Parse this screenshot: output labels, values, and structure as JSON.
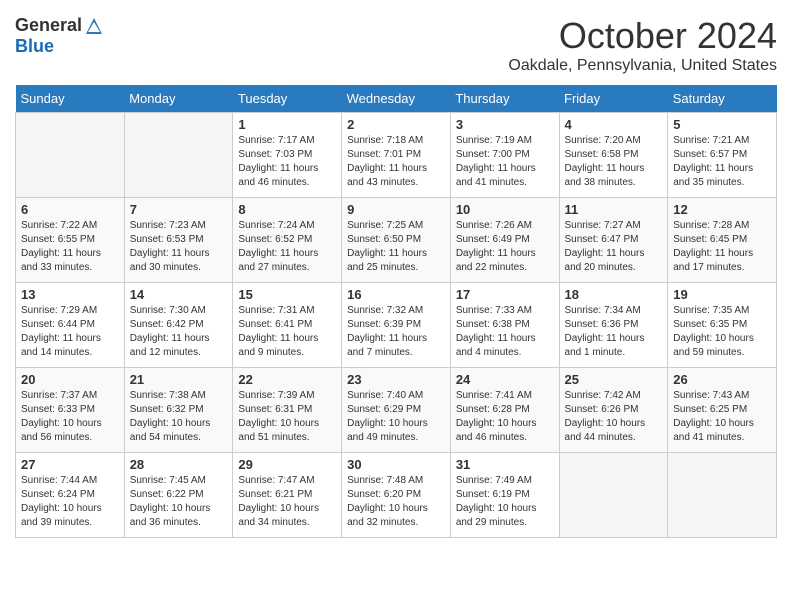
{
  "header": {
    "logo_general": "General",
    "logo_blue": "Blue",
    "month_title": "October 2024",
    "location": "Oakdale, Pennsylvania, United States"
  },
  "days_of_week": [
    "Sunday",
    "Monday",
    "Tuesday",
    "Wednesday",
    "Thursday",
    "Friday",
    "Saturday"
  ],
  "weeks": [
    [
      {
        "day": "",
        "empty": true
      },
      {
        "day": "",
        "empty": true
      },
      {
        "day": "1",
        "sunrise": "Sunrise: 7:17 AM",
        "sunset": "Sunset: 7:03 PM",
        "daylight": "Daylight: 11 hours and 46 minutes."
      },
      {
        "day": "2",
        "sunrise": "Sunrise: 7:18 AM",
        "sunset": "Sunset: 7:01 PM",
        "daylight": "Daylight: 11 hours and 43 minutes."
      },
      {
        "day": "3",
        "sunrise": "Sunrise: 7:19 AM",
        "sunset": "Sunset: 7:00 PM",
        "daylight": "Daylight: 11 hours and 41 minutes."
      },
      {
        "day": "4",
        "sunrise": "Sunrise: 7:20 AM",
        "sunset": "Sunset: 6:58 PM",
        "daylight": "Daylight: 11 hours and 38 minutes."
      },
      {
        "day": "5",
        "sunrise": "Sunrise: 7:21 AM",
        "sunset": "Sunset: 6:57 PM",
        "daylight": "Daylight: 11 hours and 35 minutes."
      }
    ],
    [
      {
        "day": "6",
        "sunrise": "Sunrise: 7:22 AM",
        "sunset": "Sunset: 6:55 PM",
        "daylight": "Daylight: 11 hours and 33 minutes."
      },
      {
        "day": "7",
        "sunrise": "Sunrise: 7:23 AM",
        "sunset": "Sunset: 6:53 PM",
        "daylight": "Daylight: 11 hours and 30 minutes."
      },
      {
        "day": "8",
        "sunrise": "Sunrise: 7:24 AM",
        "sunset": "Sunset: 6:52 PM",
        "daylight": "Daylight: 11 hours and 27 minutes."
      },
      {
        "day": "9",
        "sunrise": "Sunrise: 7:25 AM",
        "sunset": "Sunset: 6:50 PM",
        "daylight": "Daylight: 11 hours and 25 minutes."
      },
      {
        "day": "10",
        "sunrise": "Sunrise: 7:26 AM",
        "sunset": "Sunset: 6:49 PM",
        "daylight": "Daylight: 11 hours and 22 minutes."
      },
      {
        "day": "11",
        "sunrise": "Sunrise: 7:27 AM",
        "sunset": "Sunset: 6:47 PM",
        "daylight": "Daylight: 11 hours and 20 minutes."
      },
      {
        "day": "12",
        "sunrise": "Sunrise: 7:28 AM",
        "sunset": "Sunset: 6:45 PM",
        "daylight": "Daylight: 11 hours and 17 minutes."
      }
    ],
    [
      {
        "day": "13",
        "sunrise": "Sunrise: 7:29 AM",
        "sunset": "Sunset: 6:44 PM",
        "daylight": "Daylight: 11 hours and 14 minutes."
      },
      {
        "day": "14",
        "sunrise": "Sunrise: 7:30 AM",
        "sunset": "Sunset: 6:42 PM",
        "daylight": "Daylight: 11 hours and 12 minutes."
      },
      {
        "day": "15",
        "sunrise": "Sunrise: 7:31 AM",
        "sunset": "Sunset: 6:41 PM",
        "daylight": "Daylight: 11 hours and 9 minutes."
      },
      {
        "day": "16",
        "sunrise": "Sunrise: 7:32 AM",
        "sunset": "Sunset: 6:39 PM",
        "daylight": "Daylight: 11 hours and 7 minutes."
      },
      {
        "day": "17",
        "sunrise": "Sunrise: 7:33 AM",
        "sunset": "Sunset: 6:38 PM",
        "daylight": "Daylight: 11 hours and 4 minutes."
      },
      {
        "day": "18",
        "sunrise": "Sunrise: 7:34 AM",
        "sunset": "Sunset: 6:36 PM",
        "daylight": "Daylight: 11 hours and 1 minute."
      },
      {
        "day": "19",
        "sunrise": "Sunrise: 7:35 AM",
        "sunset": "Sunset: 6:35 PM",
        "daylight": "Daylight: 10 hours and 59 minutes."
      }
    ],
    [
      {
        "day": "20",
        "sunrise": "Sunrise: 7:37 AM",
        "sunset": "Sunset: 6:33 PM",
        "daylight": "Daylight: 10 hours and 56 minutes."
      },
      {
        "day": "21",
        "sunrise": "Sunrise: 7:38 AM",
        "sunset": "Sunset: 6:32 PM",
        "daylight": "Daylight: 10 hours and 54 minutes."
      },
      {
        "day": "22",
        "sunrise": "Sunrise: 7:39 AM",
        "sunset": "Sunset: 6:31 PM",
        "daylight": "Daylight: 10 hours and 51 minutes."
      },
      {
        "day": "23",
        "sunrise": "Sunrise: 7:40 AM",
        "sunset": "Sunset: 6:29 PM",
        "daylight": "Daylight: 10 hours and 49 minutes."
      },
      {
        "day": "24",
        "sunrise": "Sunrise: 7:41 AM",
        "sunset": "Sunset: 6:28 PM",
        "daylight": "Daylight: 10 hours and 46 minutes."
      },
      {
        "day": "25",
        "sunrise": "Sunrise: 7:42 AM",
        "sunset": "Sunset: 6:26 PM",
        "daylight": "Daylight: 10 hours and 44 minutes."
      },
      {
        "day": "26",
        "sunrise": "Sunrise: 7:43 AM",
        "sunset": "Sunset: 6:25 PM",
        "daylight": "Daylight: 10 hours and 41 minutes."
      }
    ],
    [
      {
        "day": "27",
        "sunrise": "Sunrise: 7:44 AM",
        "sunset": "Sunset: 6:24 PM",
        "daylight": "Daylight: 10 hours and 39 minutes."
      },
      {
        "day": "28",
        "sunrise": "Sunrise: 7:45 AM",
        "sunset": "Sunset: 6:22 PM",
        "daylight": "Daylight: 10 hours and 36 minutes."
      },
      {
        "day": "29",
        "sunrise": "Sunrise: 7:47 AM",
        "sunset": "Sunset: 6:21 PM",
        "daylight": "Daylight: 10 hours and 34 minutes."
      },
      {
        "day": "30",
        "sunrise": "Sunrise: 7:48 AM",
        "sunset": "Sunset: 6:20 PM",
        "daylight": "Daylight: 10 hours and 32 minutes."
      },
      {
        "day": "31",
        "sunrise": "Sunrise: 7:49 AM",
        "sunset": "Sunset: 6:19 PM",
        "daylight": "Daylight: 10 hours and 29 minutes."
      },
      {
        "day": "",
        "empty": true
      },
      {
        "day": "",
        "empty": true
      }
    ]
  ]
}
